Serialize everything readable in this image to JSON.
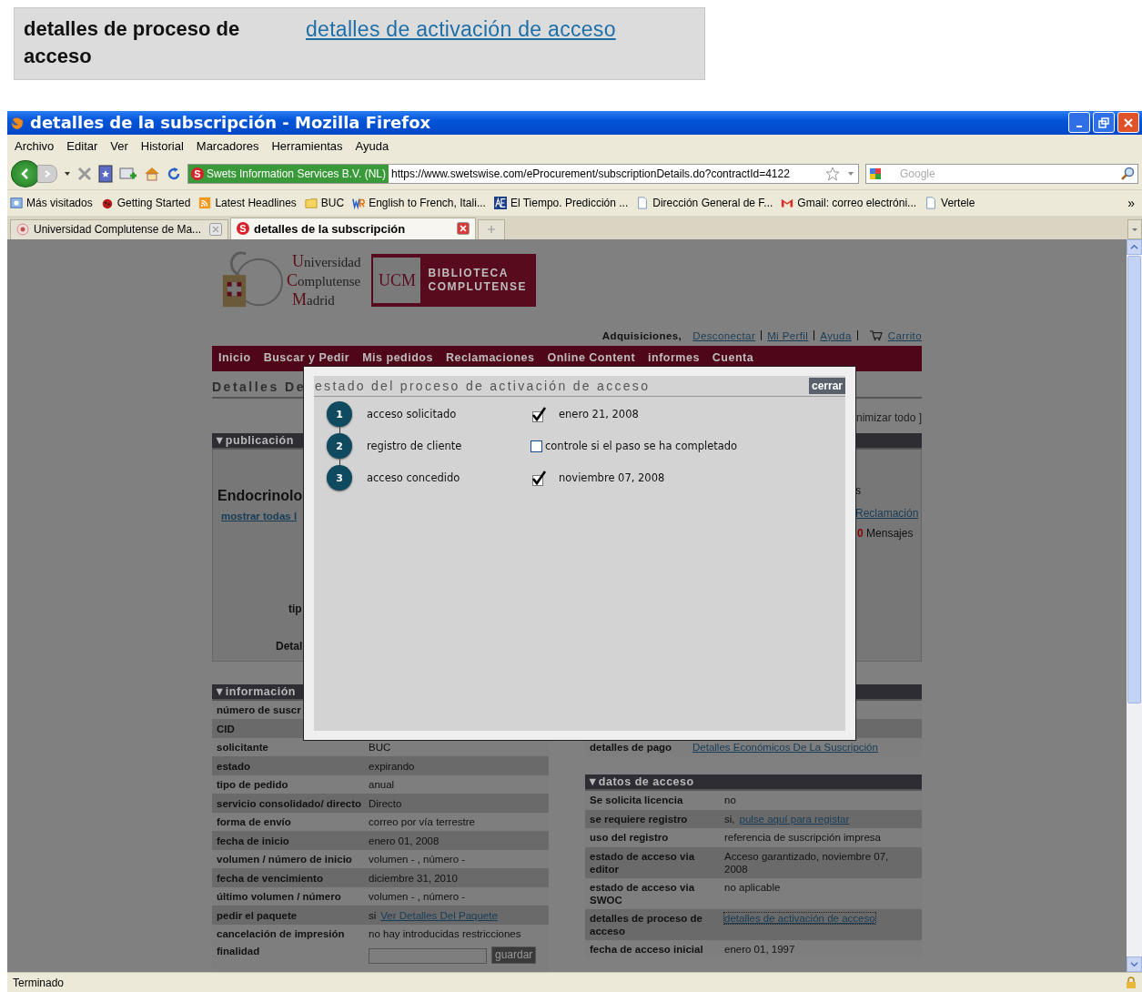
{
  "callout": {
    "label": "detalles de proceso de acceso",
    "link": "detalles de activación de acceso"
  },
  "window": {
    "title": "detalles de la subscripción - Mozilla Firefox"
  },
  "menu": [
    "Archivo",
    "Editar",
    "Ver",
    "Historial",
    "Marcadores",
    "Herramientas",
    "Ayuda"
  ],
  "toolbar": {
    "site_logo": "S",
    "site_identity": "Swets Information Services B.V. (NL)",
    "url": "https://www.swetswise.com/eProcurement/subscriptionDetails.do?contractId=4122",
    "search_placeholder": "Google"
  },
  "bookmarks": [
    {
      "label": "Más visitados",
      "kind": "smart"
    },
    {
      "label": "Getting Started",
      "kind": "ladybug"
    },
    {
      "label": "Latest Headlines",
      "kind": "feed"
    },
    {
      "label": "BUC",
      "kind": "folder"
    },
    {
      "label": "English to French, Itali...",
      "kind": "wr"
    },
    {
      "label": "El Tiempo. Predicción ...",
      "kind": "ae"
    },
    {
      "label": "Dirección General de F...",
      "kind": "page"
    },
    {
      "label": "Gmail: correo electróni...",
      "kind": "gmail"
    },
    {
      "label": "Vertele",
      "kind": "page"
    }
  ],
  "bookmarks_more": "»",
  "tabs": [
    {
      "label": "Universidad Complutense de Ma...",
      "selected": false
    },
    {
      "label": "detalles de la subscripción",
      "selected": true,
      "favicon_letter": "S"
    }
  ],
  "page": {
    "logo": {
      "university_lines": [
        "Universidad",
        "Complutense",
        "Madrid"
      ],
      "badge_initials": "UCM",
      "badge_lines": [
        "BIBLIOTECA",
        "COMPLUTENSE"
      ]
    },
    "account": {
      "label": "Adquisiciones,",
      "links": [
        "Desconectar",
        "Mi Perfil",
        "Ayuda"
      ],
      "cart": "Carrito"
    },
    "nav": [
      "Inicio",
      "Buscar y Pedir",
      "Mis pedidos",
      "Reclamaciones",
      "Online Content",
      "informes",
      "Cuenta"
    ],
    "heading": "Detalles De",
    "minimize": "nimizar todo ]",
    "publication": {
      "header": "▼publicación",
      "title": "Endocrinolo",
      "show_all": "mostrar todas l",
      "labels": [
        "tip",
        "Detal"
      ],
      "right_fragment": "s",
      "claim_link": "Reclamación",
      "message_count": "0",
      "messages": "Mensajes"
    },
    "info": {
      "header": "▼información",
      "rows": [
        {
          "label": "número de suscr"
        },
        {
          "label": "CID"
        },
        {
          "label": "solicitante",
          "value": "BUC"
        },
        {
          "label": "estado",
          "value": "expirando"
        },
        {
          "label": "tipo de pedido",
          "value": "anual"
        },
        {
          "label": "servicio consolidado/ directo",
          "value": "Directo"
        },
        {
          "label": "forma de envío",
          "value": "correo por vía terrestre"
        },
        {
          "label": "fecha de inicio",
          "value": "enero 01, 2008"
        },
        {
          "label": "volumen / número de inicio",
          "value": "volumen - ,  número -"
        },
        {
          "label": "fecha de vencimiento",
          "value": "diciembre 31, 2010"
        },
        {
          "label": "último volumen / número",
          "value": "volumen - ,  número -"
        },
        {
          "label": "pedir el paquete",
          "value": "si",
          "link": "Ver Detalles Del Paquete"
        },
        {
          "label": "cancelación de impresión",
          "value": "no hay introducidas restricciones"
        },
        {
          "label": "finalidad",
          "button": "guardar"
        }
      ]
    },
    "payment": {
      "label": "detalles de pago",
      "link": "Detalles Económicos De La Suscripción"
    },
    "access": {
      "header": "▼datos de acceso",
      "rows": [
        {
          "label": "Se solicita licencia",
          "value": "no"
        },
        {
          "label": "se requiere registro",
          "value": "si,",
          "link": "pulse aquí para registar"
        },
        {
          "label": "uso del registro",
          "value": "referencia de suscripción impresa"
        },
        {
          "label": "estado de acceso via editor",
          "value": "Acceso garantizado,  noviembre 07, 2008"
        },
        {
          "label": "estado de acceso via SWOC",
          "value": "no aplicable"
        },
        {
          "label": "detalles de proceso de acceso",
          "link": "detalles de activación de acceso"
        },
        {
          "label": "fecha de acceso inicial",
          "value": "enero 01, 1997"
        }
      ]
    }
  },
  "modal": {
    "title": "estado del proceso de activación de acceso",
    "close": "cerrar",
    "steps": [
      {
        "number": "1",
        "label": "acceso solicitado",
        "checked": true,
        "note": "enero 21, 2008"
      },
      {
        "number": "2",
        "label": "registro de cliente",
        "checked": false,
        "note": "controle si el paso se ha completado"
      },
      {
        "number": "3",
        "label": "acceso concedido",
        "checked": true,
        "note": "noviembre 07, 2008"
      }
    ]
  },
  "status_bar": {
    "text": "Terminado"
  }
}
